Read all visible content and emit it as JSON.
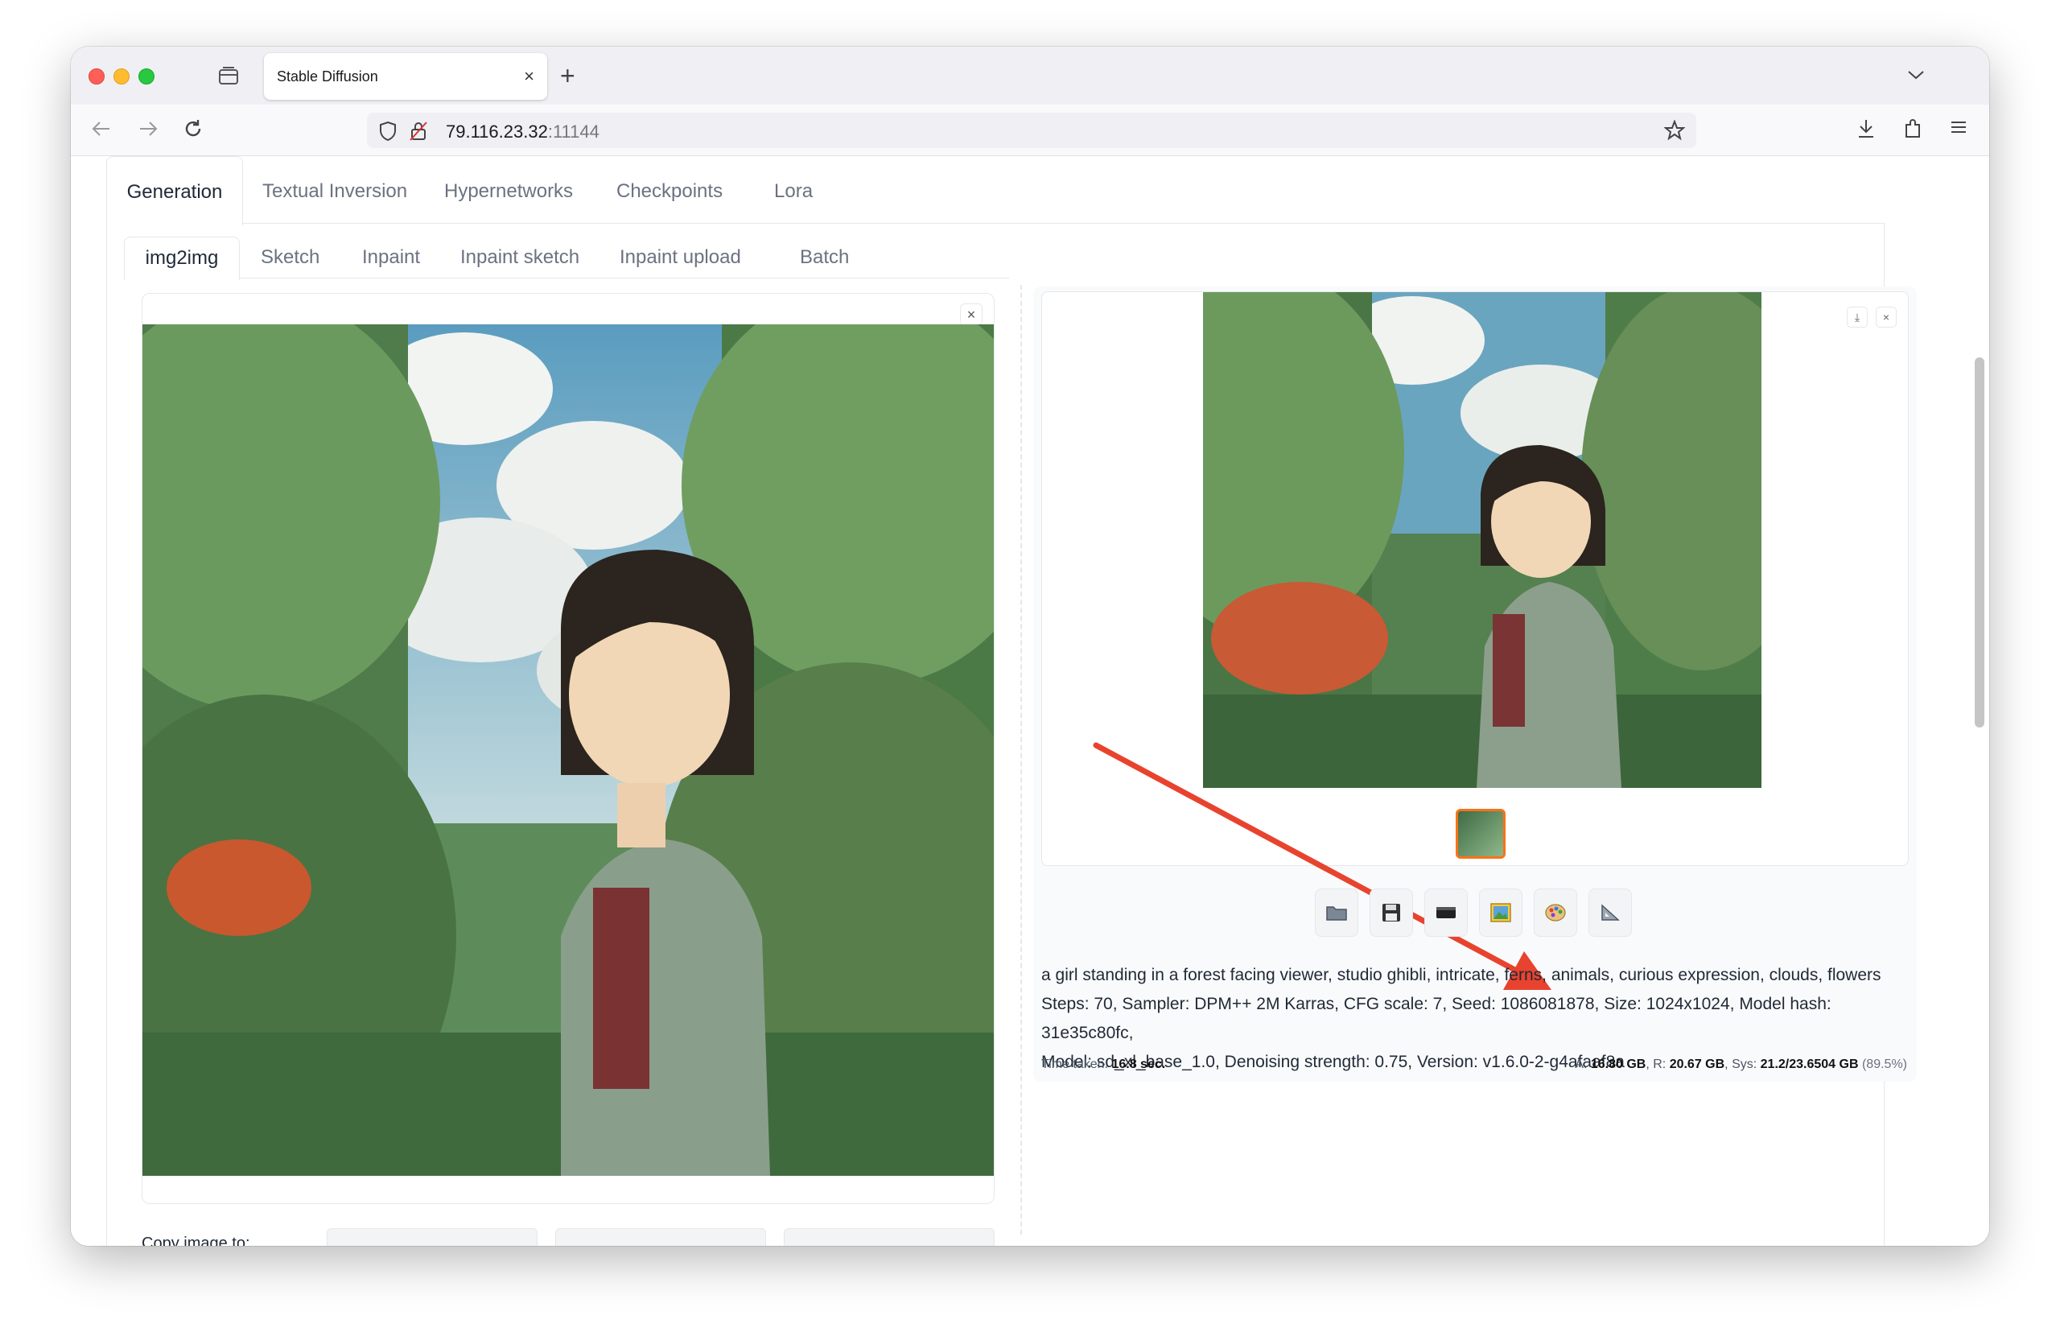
{
  "browser": {
    "tab_title": "Stable Diffusion",
    "tab_close": "×",
    "new_tab": "+",
    "url_host": "79.116.23.32",
    "url_port": ":11144"
  },
  "main_tabs": [
    "Generation",
    "Textual Inversion",
    "Hypernetworks",
    "Checkpoints",
    "Lora"
  ],
  "sub_tabs": [
    "img2img",
    "Sketch",
    "Inpaint",
    "Inpaint sketch",
    "Inpaint upload",
    "Batch"
  ],
  "left": {
    "close": "×",
    "copy_label": "Copy image to:"
  },
  "output": {
    "download": "⤓",
    "close": "×",
    "prompt": "a girl standing in a forest facing viewer, studio ghibli, intricate, ferns, animals, curious expression, clouds, flowers",
    "params_line1": "Steps: 70, Sampler: DPM++ 2M Karras, CFG scale: 7, Seed: 1086081878, Size: 1024x1024, Model hash: 31e35c80fc,",
    "params_line2": "Model: sd_xl_base_1.0, Denoising strength: 0.75, Version: v1.6.0-2-g4afaaf8a",
    "time_label": "Time taken:",
    "time_value": "16.8 sec.",
    "mem_a_label": "A:",
    "mem_a": "16.80 GB",
    "mem_r_label": ", R:",
    "mem_r": "20.67 GB",
    "mem_sys_label": ", Sys:",
    "mem_sys": "21.2/23.6504 GB",
    "mem_pct": "(89.5%)"
  },
  "toolbar_icons": [
    "open-folder-icon",
    "save-icon",
    "zip-icon",
    "send-to-img2img-icon",
    "send-to-inpaint-icon",
    "send-to-extras-icon"
  ],
  "colors": {
    "accent_orange": "#f97316",
    "annotation_arrow": "#e8432e"
  }
}
